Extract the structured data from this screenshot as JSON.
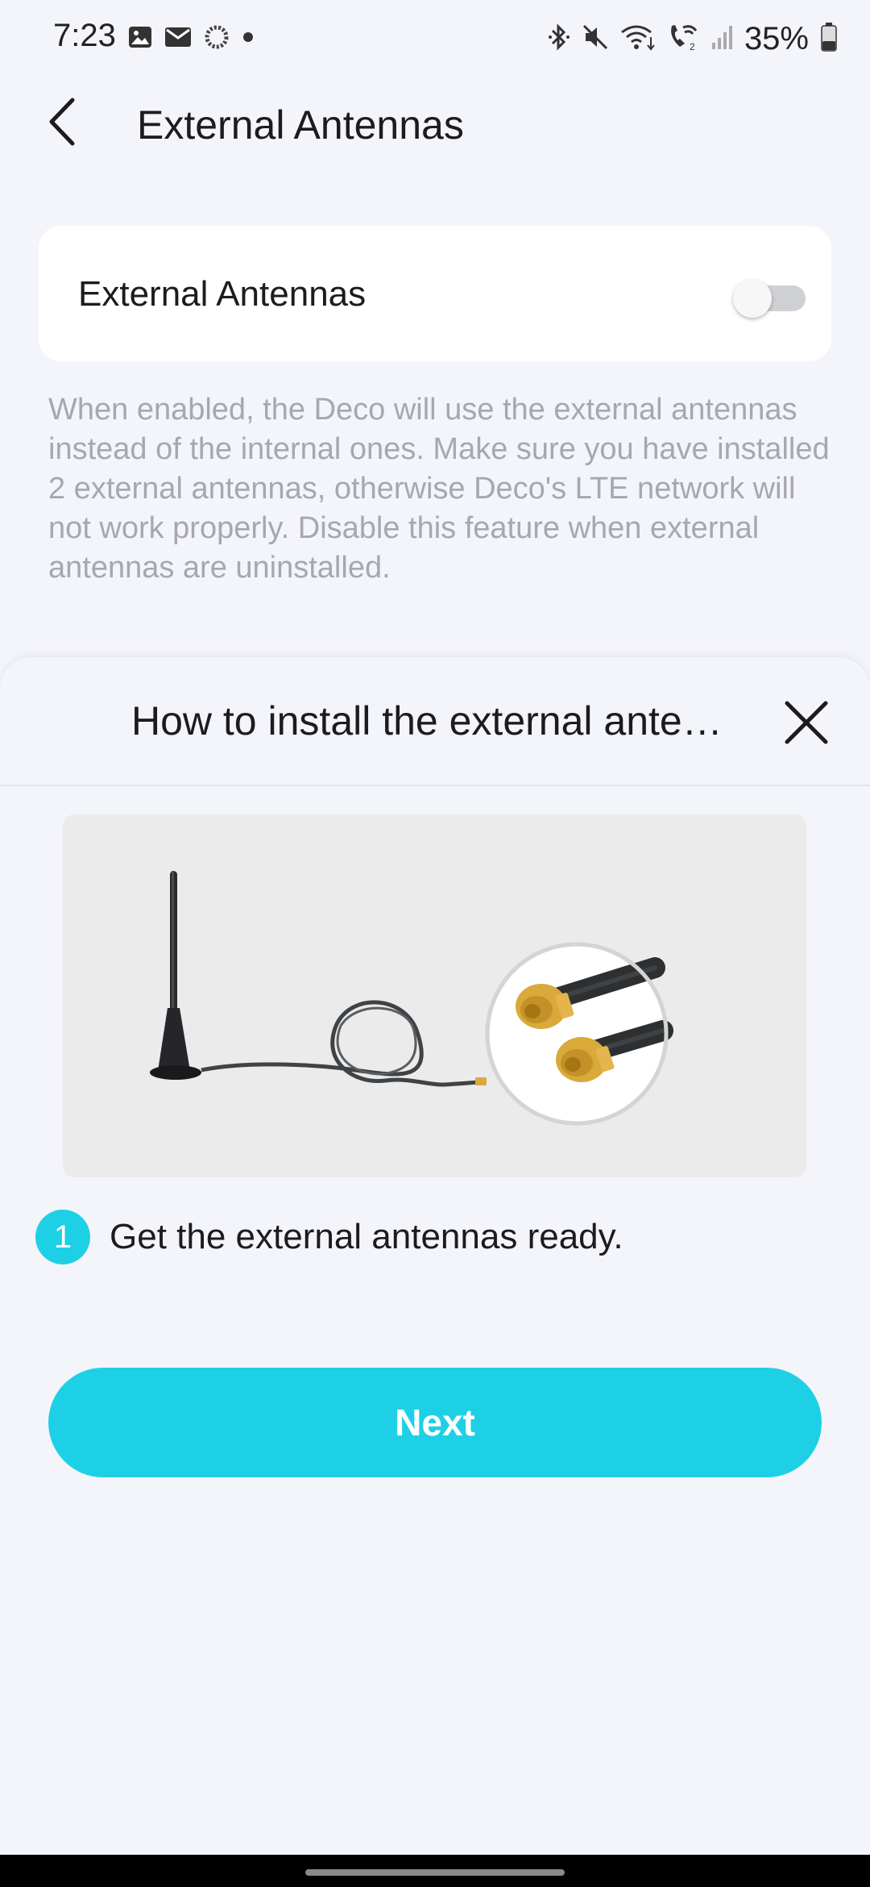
{
  "status_bar": {
    "time": "7:23",
    "battery_percent": "35%",
    "battery_level": 0.35,
    "left_icons": [
      "gallery-icon",
      "mail-icon",
      "sync-icon",
      "dot-icon"
    ],
    "right_icons": [
      "bluetooth-icon",
      "mute-icon",
      "wifi-icon",
      "wifi-calling-icon",
      "signal-icon",
      "battery-icon"
    ]
  },
  "header": {
    "title": "External Antennas",
    "back_icon": "chevron-left-icon"
  },
  "toggle_card": {
    "label": "External Antennas",
    "enabled": false
  },
  "description": "When enabled, the Deco will use the external antennas instead of the internal ones. Make sure you have installed 2 external antennas, otherwise Deco's LTE network will not work properly. Disable this feature when external antennas are uninstalled.",
  "sheet": {
    "title": "How to install the external antennas",
    "close_icon": "close-icon",
    "illustration": "external-antenna-illustration",
    "step": {
      "number": "1",
      "text": "Get the external antennas ready."
    },
    "next_label": "Next"
  },
  "colors": {
    "accent": "#1ed0e6",
    "background": "#f4f5fa",
    "card": "#ffffff",
    "muted_text": "#a6a8ae",
    "connector_gold": "#d9a93a"
  }
}
